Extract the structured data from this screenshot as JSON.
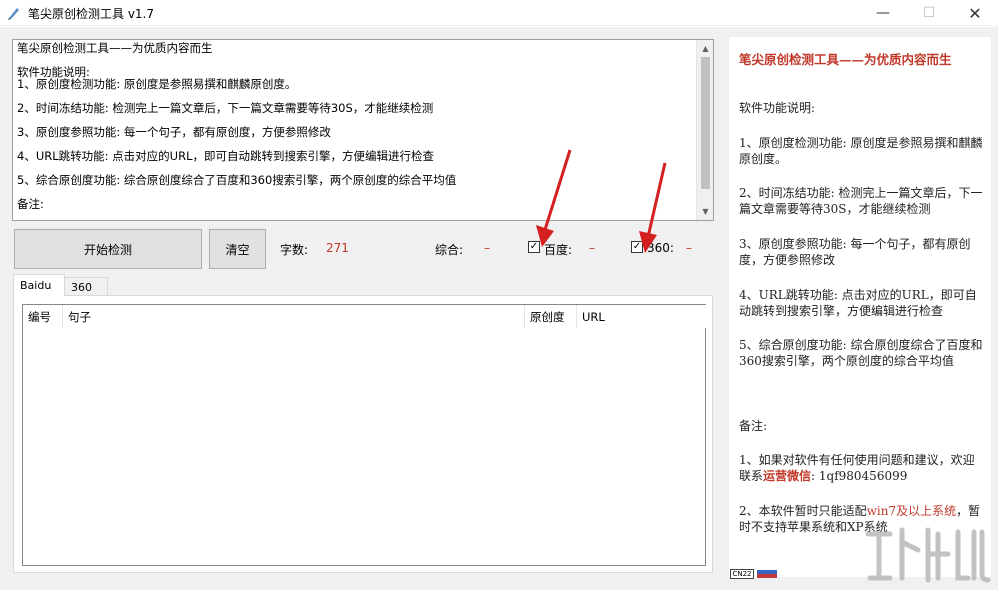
{
  "window": {
    "title": "笔尖原创检测工具 v1.7",
    "minimize": "—",
    "maximize": "☐",
    "close": "✕"
  },
  "description": {
    "lines": [
      "笔尖原创检测工具——为优质内容而生",
      "",
      "软件功能说明:",
      "1、原创度检测功能: 原创度是参照易撰和麒麟原创度。",
      "",
      "2、时间冻结功能: 检测完上一篇文章后，下一篇文章需要等待30S，才能继续检测",
      "",
      "3、原创度参照功能: 每一个句子，都有原创度，方便参照修改",
      "",
      "4、URL跳转功能: 点击对应的URL，即可自动跳转到搜索引擎，方便编辑进行检查",
      "",
      "5、综合原创度功能: 综合原创度综合了百度和360搜索引擎，两个原创度的综合平均值",
      "",
      "备注:"
    ]
  },
  "toolbar": {
    "start_label": "开始检测",
    "clear_label": "清空",
    "word_count_label": "字数:",
    "word_count_value": "271",
    "overall_label": "综合:",
    "overall_value": "–",
    "baidu_label": "百度:",
    "baidu_value": "–",
    "baidu_checked": "✓",
    "s360_label": "360:",
    "s360_value": "–",
    "s360_checked": "✓"
  },
  "tabs": [
    "Baidu",
    "360"
  ],
  "table": {
    "columns": [
      "编号",
      "句子",
      "原创度",
      "URL"
    ]
  },
  "info": {
    "title": "笔尖原创检测工具——为优质内容而生",
    "heading": "软件功能说明:",
    "item1": "1、原创度检测功能: 原创度是参照易撰和麒麟原创度。",
    "item2": "2、时间冻结功能: 检测完上一篇文章后，下一篇文章需要等待30S，才能继续检测",
    "item3": "3、原创度参照功能: 每一个句子，都有原创度，方便参照修改",
    "item4": "4、URL跳转功能: 点击对应的URL，即可自动跳转到搜索引擎，方便编辑进行检查",
    "item5": "5、综合原创度功能: 综合原创度综合了百度和360搜索引擎，两个原创度的综合平均值",
    "note_heading": "备注:",
    "note1_prefix": "1、如果对软件有任何使用问题和建议，欢迎联系",
    "note1_highlight": "运营微信",
    "note1_suffix": ": 1qf980456099",
    "note2_prefix": "2、本软件暂时只能适配",
    "note2_highlight": "win7及以上系统",
    "note2_suffix": "，暂时不支持苹果系统和XP系统"
  },
  "taskbar": {
    "lang": "CN22"
  },
  "colors": {
    "accent_red": "#c0392b",
    "arrow_red": "#d42020"
  }
}
